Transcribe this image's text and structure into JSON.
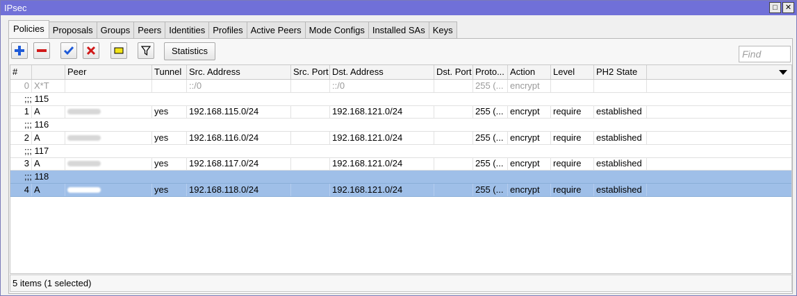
{
  "window": {
    "title": "IPsec"
  },
  "tabs": [
    "Policies",
    "Proposals",
    "Groups",
    "Peers",
    "Identities",
    "Profiles",
    "Active Peers",
    "Mode Configs",
    "Installed SAs",
    "Keys"
  ],
  "toolbar": {
    "icons": [
      "plus-icon",
      "minus-icon",
      "check-icon",
      "cross-icon",
      "comment-icon",
      "filter-icon"
    ],
    "statistics_label": "Statistics",
    "find_placeholder": "Find"
  },
  "colors": {
    "title_bar": "#7070d8",
    "selection": "#9fbfe8",
    "add": "#1f5bd8",
    "remove": "#d01818",
    "enable": "#1f5bd8",
    "disable": "#d01818"
  },
  "table": {
    "columns": [
      "#",
      "",
      "Peer",
      "Tunnel",
      "Src. Address",
      "Src. Port",
      "Dst. Address",
      "Dst. Port",
      "Proto...",
      "Action",
      "Level",
      "PH2 State"
    ],
    "rows": [
      {
        "type": "data",
        "disabled": true,
        "selected": false,
        "num": "0",
        "flags": "X*T",
        "peer": "",
        "tunnel": "",
        "src": "::/0",
        "sport": "",
        "dst": "::/0",
        "dport": "",
        "proto": "255 (...",
        "action": "encrypt",
        "level": "",
        "ph2": ""
      },
      {
        "type": "comment",
        "selected": false,
        "text": ";;; 115"
      },
      {
        "type": "data",
        "disabled": false,
        "selected": false,
        "num": "1",
        "flags": "A",
        "peer": "",
        "tunnel": "yes",
        "src": "192.168.115.0/24",
        "sport": "",
        "dst": "192.168.121.0/24",
        "dport": "",
        "proto": "255 (...",
        "action": "encrypt",
        "level": "require",
        "ph2": "established"
      },
      {
        "type": "comment",
        "selected": false,
        "text": ";;; 116"
      },
      {
        "type": "data",
        "disabled": false,
        "selected": false,
        "num": "2",
        "flags": "A",
        "peer": "",
        "tunnel": "yes",
        "src": "192.168.116.0/24",
        "sport": "",
        "dst": "192.168.121.0/24",
        "dport": "",
        "proto": "255 (...",
        "action": "encrypt",
        "level": "require",
        "ph2": "established"
      },
      {
        "type": "comment",
        "selected": false,
        "text": ";;; 117"
      },
      {
        "type": "data",
        "disabled": false,
        "selected": false,
        "num": "3",
        "flags": "A",
        "peer": "",
        "tunnel": "yes",
        "src": "192.168.117.0/24",
        "sport": "",
        "dst": "192.168.121.0/24",
        "dport": "",
        "proto": "255 (...",
        "action": "encrypt",
        "level": "require",
        "ph2": "established"
      },
      {
        "type": "comment",
        "selected": true,
        "text": ";;; 118"
      },
      {
        "type": "data",
        "disabled": false,
        "selected": true,
        "num": "4",
        "flags": "A",
        "peer": "",
        "tunnel": "yes",
        "src": "192.168.118.0/24",
        "sport": "",
        "dst": "192.168.121.0/24",
        "dport": "",
        "proto": "255 (...",
        "action": "encrypt",
        "level": "require",
        "ph2": "established"
      }
    ]
  },
  "status": {
    "text": "5 items (1 selected)"
  }
}
